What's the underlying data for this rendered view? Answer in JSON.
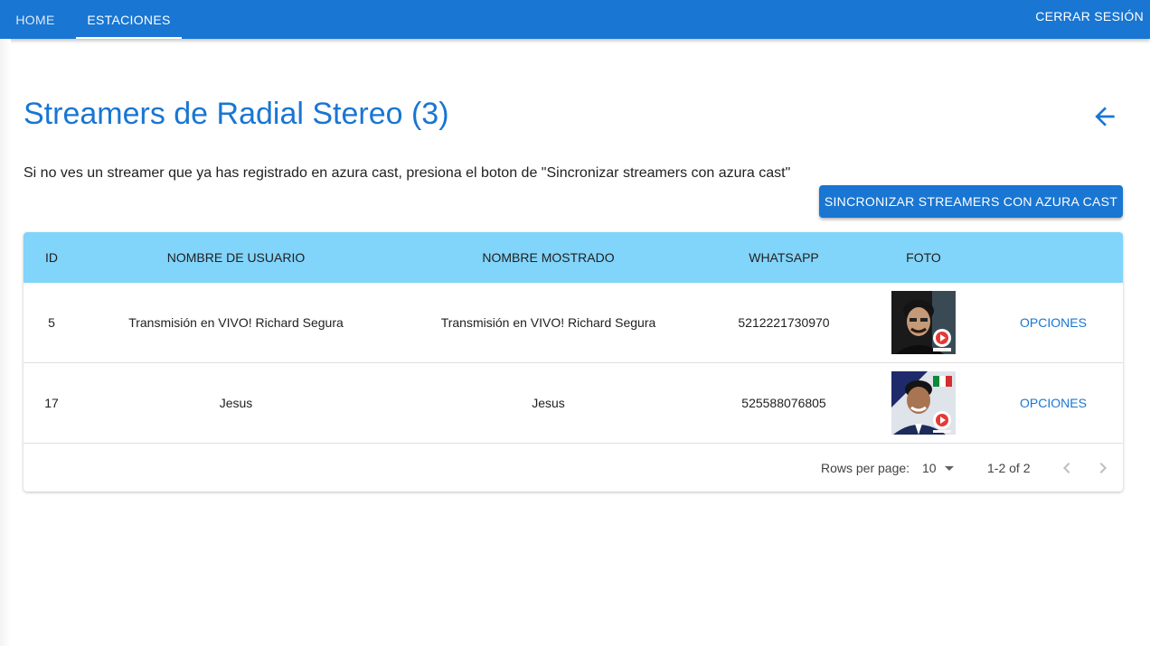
{
  "nav": {
    "tabs": [
      {
        "label": "Home"
      },
      {
        "label": "Estaciones"
      }
    ],
    "logout_label": "Cerrar sesión"
  },
  "page": {
    "title": "Streamers de Radial Stereo (3)",
    "info": "Si no ves un streamer que ya has registrado en azura cast, presiona el boton de \"Sincronizar streamers con azura cast\"",
    "sync_label": "Sincronizar streamers con azura cast",
    "back_icon": "arrow-left-icon"
  },
  "table": {
    "headers": {
      "id": "ID",
      "username": "Nombre de usuario",
      "display_name": "Nombre mostrado",
      "whatsapp": "Whatsapp",
      "photo": "Foto"
    },
    "rows": [
      {
        "id": "5",
        "username": "Transmisión en VIVO! Richard Segura",
        "display_name": "Transmisión en VIVO! Richard Segura",
        "whatsapp": "5212221730970",
        "options": "Opciones"
      },
      {
        "id": "17",
        "username": "Jesus",
        "display_name": "Jesus",
        "whatsapp": "525588076805",
        "options": "Opciones"
      }
    ],
    "footer": {
      "rows_per_page_label": "Rows per page:",
      "rows_per_page_value": "10",
      "range": "1-2 of 2"
    }
  },
  "colors": {
    "primary": "#1976d2",
    "header": "#81d4fa"
  }
}
